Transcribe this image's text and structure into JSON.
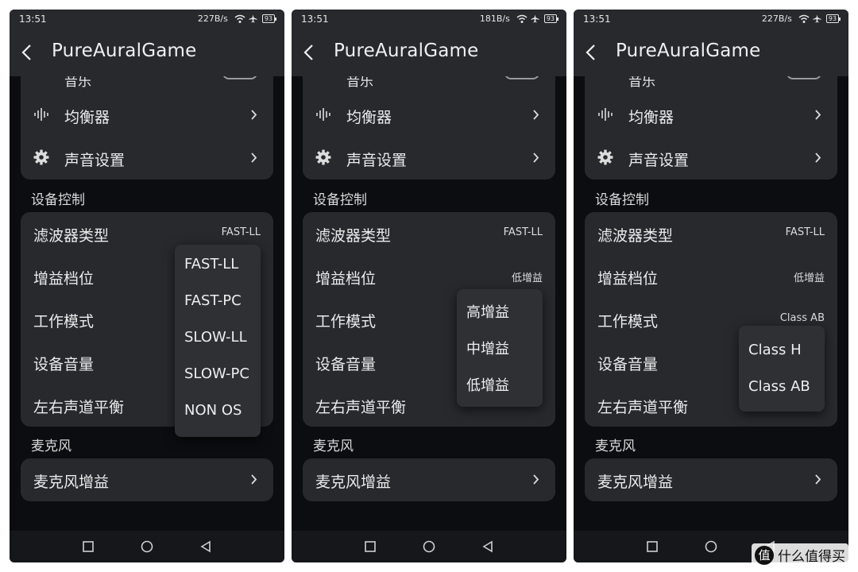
{
  "app_title": "PureAuralGame",
  "section_device": "设备控制",
  "section_mic": "麦克风",
  "partial_top_label": "音乐",
  "menu": {
    "equalizer": "均衡器",
    "sound_settings": "声音设置"
  },
  "device_rows": {
    "filter_type": "滤波器类型",
    "gain_level": "增益档位",
    "work_mode": "工作模式",
    "device_volume": "设备音量",
    "lr_balance": "左右声道平衡"
  },
  "mic_gain": "麦克风增益",
  "icons": {
    "back": "back-arrow-icon",
    "equalizer": "waveform-icon",
    "settings": "gear-icon",
    "chevron": "chevron-right-icon",
    "nav_recent": "square-icon",
    "nav_home": "circle-icon",
    "nav_back": "triangle-back-icon"
  },
  "colors": {
    "background": "#0c0d10",
    "card": "#27292d",
    "popup": "#2e3034",
    "text": "#ebebeb"
  },
  "screens": [
    {
      "status": {
        "time": "13:51",
        "speed": "227B/s",
        "battery": "93"
      },
      "filter_value": "FAST-LL",
      "gain_value": "",
      "mode_value": "",
      "popup_options": [
        "FAST-LL",
        "FAST-PC",
        "SLOW-LL",
        "SLOW-PC",
        "NON OS"
      ]
    },
    {
      "status": {
        "time": "13:51",
        "speed": "181B/s",
        "battery": "93"
      },
      "filter_value": "FAST-LL",
      "gain_value": "低增益",
      "mode_value": "",
      "popup_options": [
        "高增益",
        "中增益",
        "低增益"
      ]
    },
    {
      "status": {
        "time": "13:51",
        "speed": "227B/s",
        "battery": "93"
      },
      "filter_value": "FAST-LL",
      "gain_value": "低增益",
      "mode_value": "Class AB",
      "popup_options": [
        "Class H",
        "Class AB"
      ]
    }
  ],
  "watermark": {
    "logo_char": "值",
    "text": "什么值得买"
  }
}
